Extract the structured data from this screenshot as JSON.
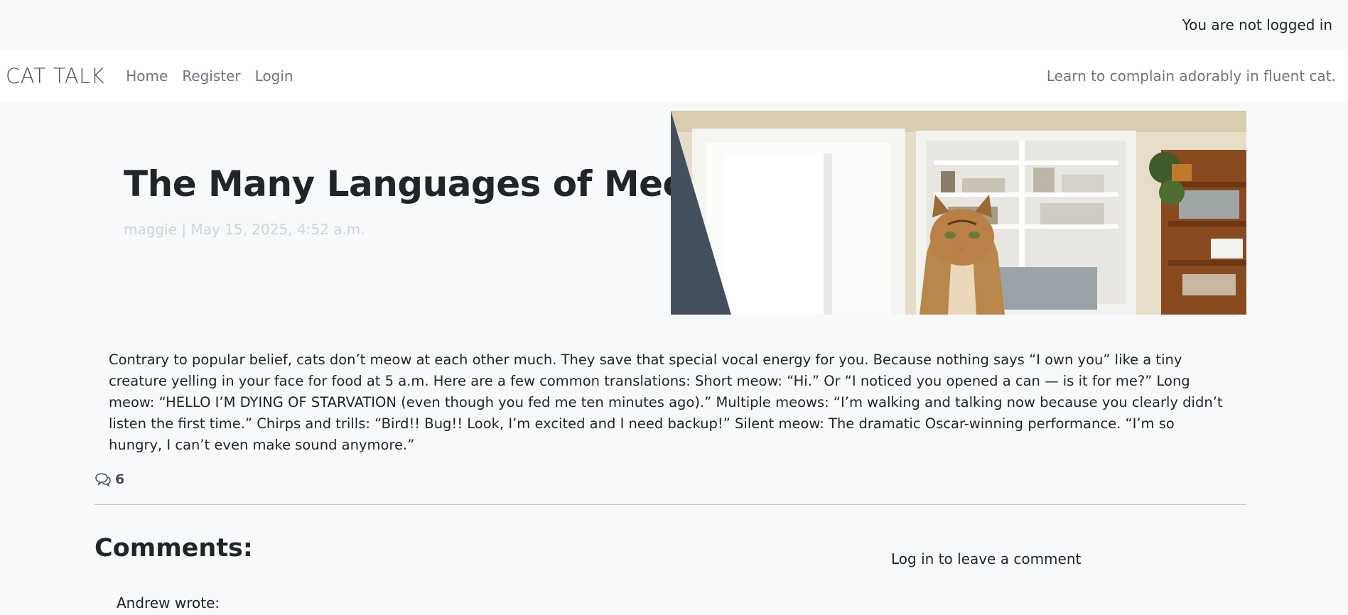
{
  "topbar": {
    "status": "You are not logged in"
  },
  "navbar": {
    "brand": "CAT TALK",
    "links": [
      {
        "label": "Home"
      },
      {
        "label": "Register"
      },
      {
        "label": "Login"
      }
    ],
    "tagline": "Learn to complain adorably in fluent cat."
  },
  "post": {
    "title": "The Many Languages of Meow",
    "meta": "maggie | May 15, 2025, 4:52 a.m.",
    "image_icon": "cat-photo",
    "body": "Contrary to popular belief, cats don’t meow at each other much. They save that special vocal energy for you. Because nothing says “I own you” like a tiny creature yelling in your face for food at 5 a.m. Here are a few common translations: Short meow: “Hi.” Or “I noticed you opened a can — is it for me?” Long meow: “HELLO I’M DYING OF STARVATION (even though you fed me ten minutes ago).” Multiple meows: “I’m walking and talking now because you clearly didn’t listen the first time.” Chirps and trills: “Bird!! Bug!! Look, I’m excited and I need backup!” Silent meow: The dramatic Oscar-winning performance. “I’m so hungry, I can’t even make sound anymore.”",
    "comment_count": "6",
    "comment_icon": "comments-icon"
  },
  "comments": {
    "heading": "Comments:",
    "login_prompt": "Log in to leave a comment",
    "items": [
      {
        "author_line": "Andrew wrote:"
      }
    ]
  },
  "colors": {
    "accent_slate": "#444f5d",
    "background": "#f8f9fa",
    "navbar": "#ffffff"
  }
}
